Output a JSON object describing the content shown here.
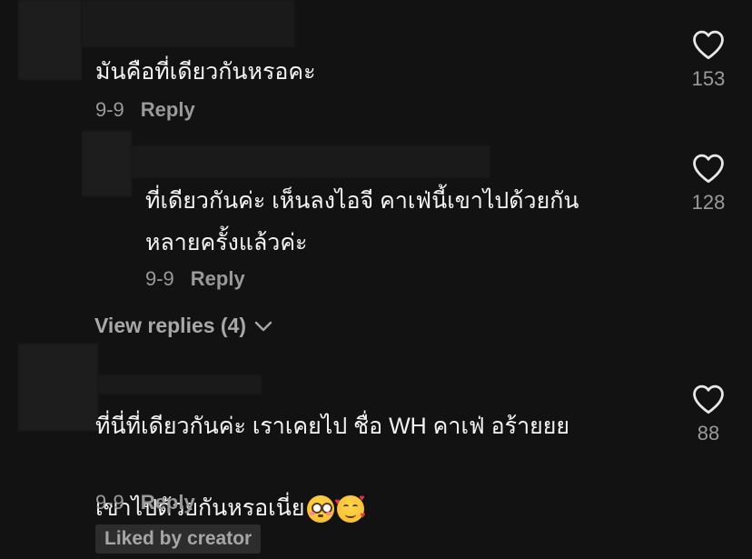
{
  "comments": [
    {
      "text": "มันคือที่เดียวกันหรอคะ",
      "date": "9-9",
      "reply_label": "Reply",
      "likes": "153"
    },
    {
      "text": "ที่เดียวกันค่ะ เห็นลงไอจี คาเฟ่นี้เขาไปด้วยกัน\nหลายครั้งแล้วค่ะ",
      "date": "9-9",
      "reply_label": "Reply",
      "likes": "128"
    },
    {
      "text_line1": "ที่นี่ที่เดียวกันค่ะ เราเคยไป ชื่อ WH คาเฟ่ อร้ายยย",
      "text_line2": "เขาไปด้วยกันหรอเนี่ย",
      "emojis": [
        "flushed-face",
        "smiling-face-with-hearts"
      ],
      "date": "9-9",
      "reply_label": "Reply",
      "likes": "88",
      "liked_badge": "Liked by creator"
    }
  ],
  "view_replies": "View replies (4)",
  "colors": {
    "background": "#121212",
    "text": "#f4f4f4",
    "muted": "#9a9a9a",
    "badge_bg": "#2d2d2d"
  }
}
